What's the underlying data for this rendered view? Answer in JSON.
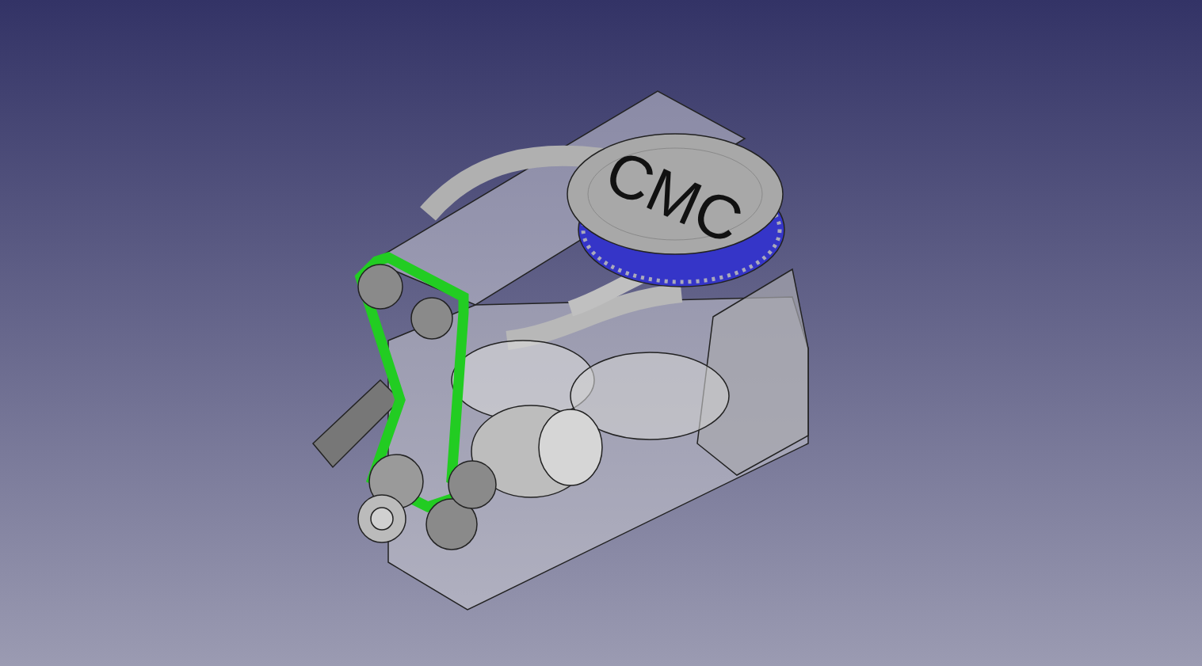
{
  "viewport": {
    "model": {
      "kind": "engine",
      "label": "CMC"
    }
  }
}
